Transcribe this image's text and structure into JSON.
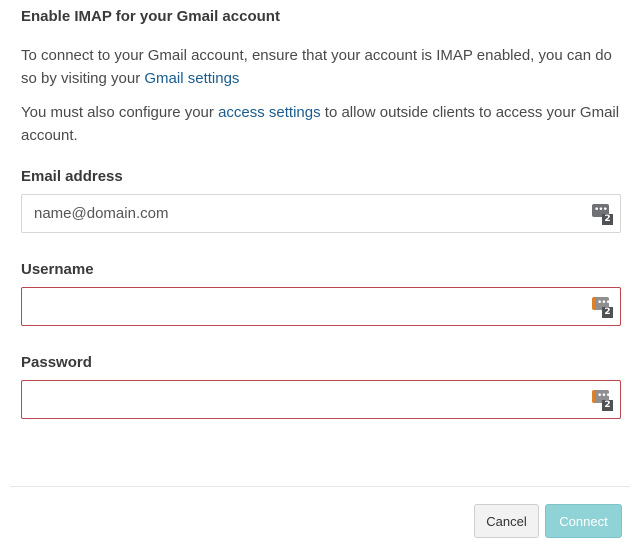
{
  "dialog": {
    "title": "Enable IMAP for your Gmail account",
    "intro_text": "To connect to your Gmail account, ensure that your account is IMAP enabled, you can do so by visiting your ",
    "intro_link": "Gmail settings",
    "access_text_before": "You must also configure your ",
    "access_link": "access settings",
    "access_text_after": " to allow outside clients to access your Gmail account."
  },
  "form": {
    "email": {
      "label": "Email address",
      "placeholder": "name@domain.com",
      "value": ""
    },
    "username": {
      "label": "Username",
      "value": ""
    },
    "password": {
      "label": "Password",
      "value": ""
    },
    "password_manager_badge": "2"
  },
  "footer": {
    "cancel_label": "Cancel",
    "connect_label": "Connect"
  },
  "colors": {
    "link": "#1a5c8e",
    "invalid_border": "#b9474f",
    "connect_button": "#8fd3d6"
  }
}
